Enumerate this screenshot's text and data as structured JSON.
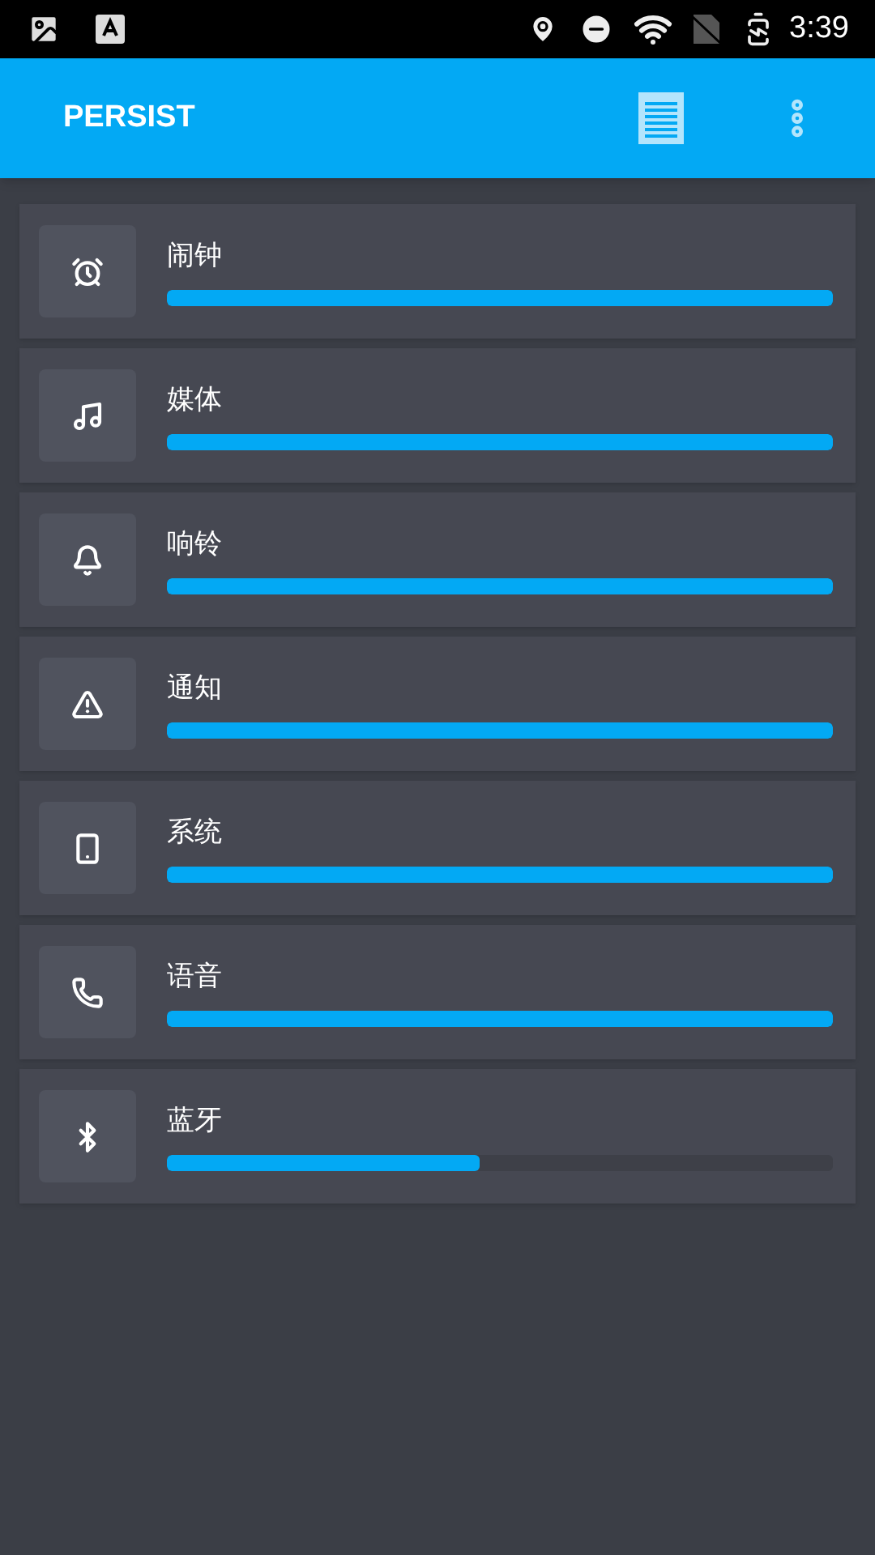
{
  "status_bar": {
    "time": "3:39"
  },
  "app_bar": {
    "title": "PERSIST"
  },
  "channels": [
    {
      "kind": "alarm",
      "name": "闹钟",
      "level": 1
    },
    {
      "kind": "media",
      "name": "媒体",
      "level": 1
    },
    {
      "kind": "ring",
      "name": "响铃",
      "level": 1
    },
    {
      "kind": "notification",
      "name": "通知",
      "level": 1
    },
    {
      "kind": "system",
      "name": "系统",
      "level": 1
    },
    {
      "kind": "voice",
      "name": "语音",
      "level": 1
    },
    {
      "kind": "bluetooth",
      "name": "蓝牙",
      "level": 0.47
    }
  ]
}
